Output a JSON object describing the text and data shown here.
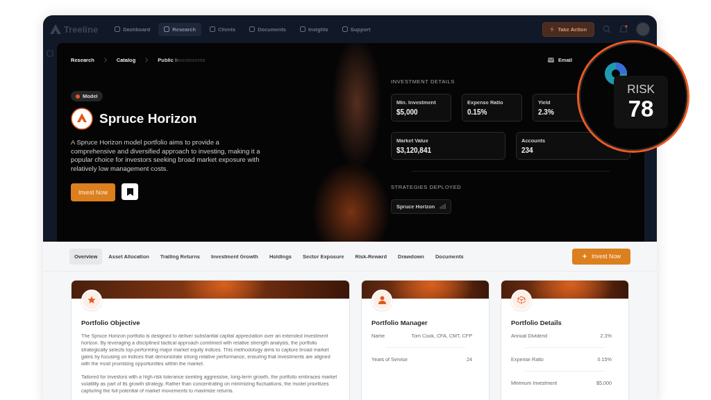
{
  "nav": {
    "brand": "Treeline",
    "items": [
      {
        "label": "Dashboard",
        "selected": false
      },
      {
        "label": "Research",
        "selected": true
      },
      {
        "label": "Clients",
        "selected": false
      },
      {
        "label": "Documents",
        "selected": false
      },
      {
        "label": "Insights",
        "selected": false
      },
      {
        "label": "Support",
        "selected": false
      }
    ],
    "action": "Take Action",
    "notification": true
  },
  "breadcrumb": [
    "Research",
    "Catalog",
    "Public Investments"
  ],
  "email": "Email",
  "badge": "Model",
  "title": "Spruce Horizon",
  "description": "A Spruce Horizon model portfolio aims to provide a comprehensive and diversified approach to investing, making it a popular choice for investors seeking broad market exposure with relatively low management costs.",
  "invest_button": "Invest Now",
  "investment_details": {
    "heading": "INVESTMENT DETAILS",
    "metrics": [
      {
        "label": "Min. Investment",
        "value": "$5,000"
      },
      {
        "label": "Expense Ratio",
        "value": "0.15%"
      },
      {
        "label": "Yield",
        "value": "2.3%"
      },
      {
        "label": "Market Value",
        "value": "$3,120,841"
      },
      {
        "label": "Accounts",
        "value": "234"
      }
    ]
  },
  "strategies": {
    "heading": "STRATEGIES DEPLOYED",
    "items": [
      "Spruce Horizon"
    ]
  },
  "risk_callout": {
    "label": "RISK",
    "value": "78"
  },
  "tabs": [
    {
      "label": "Overview",
      "selected": true
    },
    {
      "label": "Asset Allocation",
      "selected": false
    },
    {
      "label": "Trailing Returns",
      "selected": false
    },
    {
      "label": "Investment Growth",
      "selected": false
    },
    {
      "label": "Holdings",
      "selected": false
    },
    {
      "label": "Sector Exposure",
      "selected": false
    },
    {
      "label": "Risk-Reward",
      "selected": false
    },
    {
      "label": "Drawdown",
      "selected": false
    },
    {
      "label": "Documents",
      "selected": false
    }
  ],
  "tab_action": "Invest Now",
  "cards": [
    {
      "kind": "text",
      "title": "Portfolio Objective",
      "paragraphs": [
        "The Spruce Horizon portfolio is designed to deliver substantial capital appreciation over an extended investment horizon. By leveraging a disciplined tactical approach combined with relative strength analysis, the portfolio strategically selects top-performing major market equity indices. This methodology aims to capture broad market gains by focusing on indices that demonstrate strong relative performance, ensuring that investments are aligned with the most promising opportunities within the market.",
        "Tailored for investors with a high-risk tolerance seeking aggressive, long-term growth, the portfolio embraces market volatility as part of its growth strategy. Rather than concentrating on minimizing fluctuations, the model prioritizes capturing the full potential of market movements to maximize returns."
      ]
    },
    {
      "kind": "rows",
      "title": "Portfolio Manager",
      "rows": [
        {
          "label": "Name",
          "value": "Tom Cook, CFA, CMT, CFP"
        },
        {
          "label": "Years of Service",
          "value": "24"
        }
      ]
    },
    {
      "kind": "rows",
      "title": "Portfolio Details",
      "rows": [
        {
          "label": "Annual Dividend",
          "value": "2.3%"
        },
        {
          "label": "Expense Ratio",
          "value": "0.15%"
        },
        {
          "label": "Minimum Investment",
          "value": "$5,000"
        }
      ]
    }
  ]
}
